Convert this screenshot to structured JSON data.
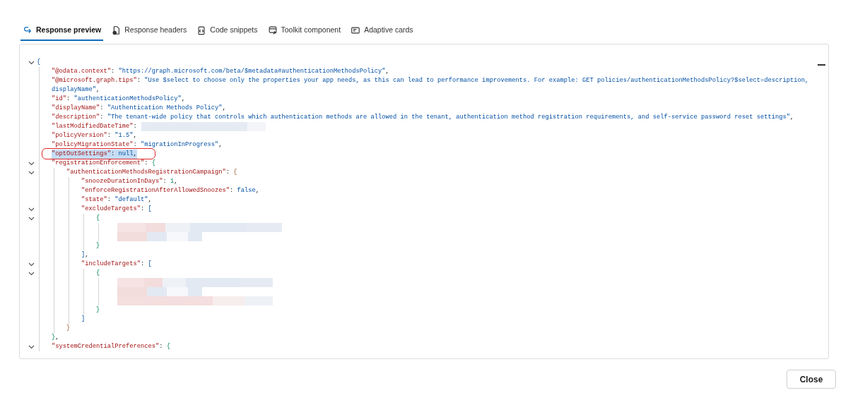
{
  "tabs": [
    {
      "label": "Response preview",
      "selected": true
    },
    {
      "label": "Response headers",
      "selected": false
    },
    {
      "label": "Code snippets",
      "selected": false
    },
    {
      "label": "Toolkit component",
      "selected": false
    },
    {
      "label": "Adaptive cards",
      "selected": false
    }
  ],
  "code": {
    "open": "{",
    "expanded": true,
    "children": [
      {
        "key": "\"@odata.context\"",
        "sep": ": ",
        "value": "\"https://graph.microsoft.com/beta/$metadata#authenticationMethodsPolicy\"",
        "kind": "string",
        "tail": ","
      },
      {
        "key": "\"@microsoft.graph.tips\"",
        "sep": ": ",
        "value": "\"Use $select to choose only the properties your app needs, as this can lead to performance improvements. For example: GET policies/authenticationMethodsPolicy?$select=description,",
        "continued": "displayName\"",
        "kind": "string",
        "tail": ","
      },
      {
        "key": "\"id\"",
        "sep": ": ",
        "value": "\"authenticationMethodsPolicy\"",
        "kind": "string",
        "tail": ","
      },
      {
        "key": "\"displayName\"",
        "sep": ": ",
        "value": "\"Authentication Methods Policy\"",
        "kind": "string",
        "tail": ","
      },
      {
        "key": "\"description\"",
        "sep": ": ",
        "value": "\"The tenant-wide policy that controls which authentication methods are allowed in the tenant, authentication method registration requirements, and self-service password reset settings\"",
        "kind": "string",
        "tail": ","
      },
      {
        "key": "\"lastModifiedDateTime\"",
        "sep": ":",
        "kind": "redactedvalue"
      },
      {
        "key": "\"policyVersion\"",
        "sep": ": ",
        "value": "\"1.5\"",
        "kind": "string",
        "tail": ","
      },
      {
        "key": "\"policyMigrationState\"",
        "sep": ": ",
        "value": "\"migrationInProgress\"",
        "kind": "string",
        "tail": ","
      },
      {
        "key": "\"optOutSettings\"",
        "sep": ": ",
        "value": "null",
        "kind": "literal",
        "tail": ",",
        "highlighted": true,
        "circled": true
      },
      {
        "key": "\"registrationEnforcement\"",
        "sep": ": ",
        "open": "{",
        "close": "}",
        "close_tail": ",",
        "expanded": true,
        "children": [
          {
            "key": "\"authenticationMethodsRegistrationCampaign\"",
            "sep": ": ",
            "open": "{",
            "close": "}",
            "expanded": true,
            "children": [
              {
                "key": "\"snoozeDurationInDays\"",
                "sep": ": ",
                "value": "1",
                "kind": "number",
                "tail": ","
              },
              {
                "key": "\"enforceRegistrationAfterAllowedSnoozes\"",
                "sep": ": ",
                "value": "false",
                "kind": "literal",
                "tail": ","
              },
              {
                "key": "\"state\"",
                "sep": ": ",
                "value": "\"default\"",
                "kind": "string",
                "tail": ","
              },
              {
                "key": "\"excludeTargets\"",
                "sep": ": ",
                "open": "[",
                "close": "]",
                "close_tail": ",",
                "expanded": true,
                "children": [
                  {
                    "open": "{",
                    "close": "}",
                    "expanded": true,
                    "children": [
                      {
                        "kind": "redacted"
                      }
                    ]
                  }
                ]
              },
              {
                "key": "\"includeTargets\"",
                "sep": ": ",
                "open": "[",
                "close": "]",
                "expanded": true,
                "children": [
                  {
                    "open": "{",
                    "close": "}",
                    "expanded": true,
                    "children": [
                      {
                        "kind": "redactedtall"
                      }
                    ]
                  }
                ]
              }
            ]
          }
        ]
      },
      {
        "key": "\"systemCredentialPreferences\"",
        "sep": ": ",
        "open": "{",
        "expanded": true
      }
    ]
  },
  "close_button": "Close"
}
